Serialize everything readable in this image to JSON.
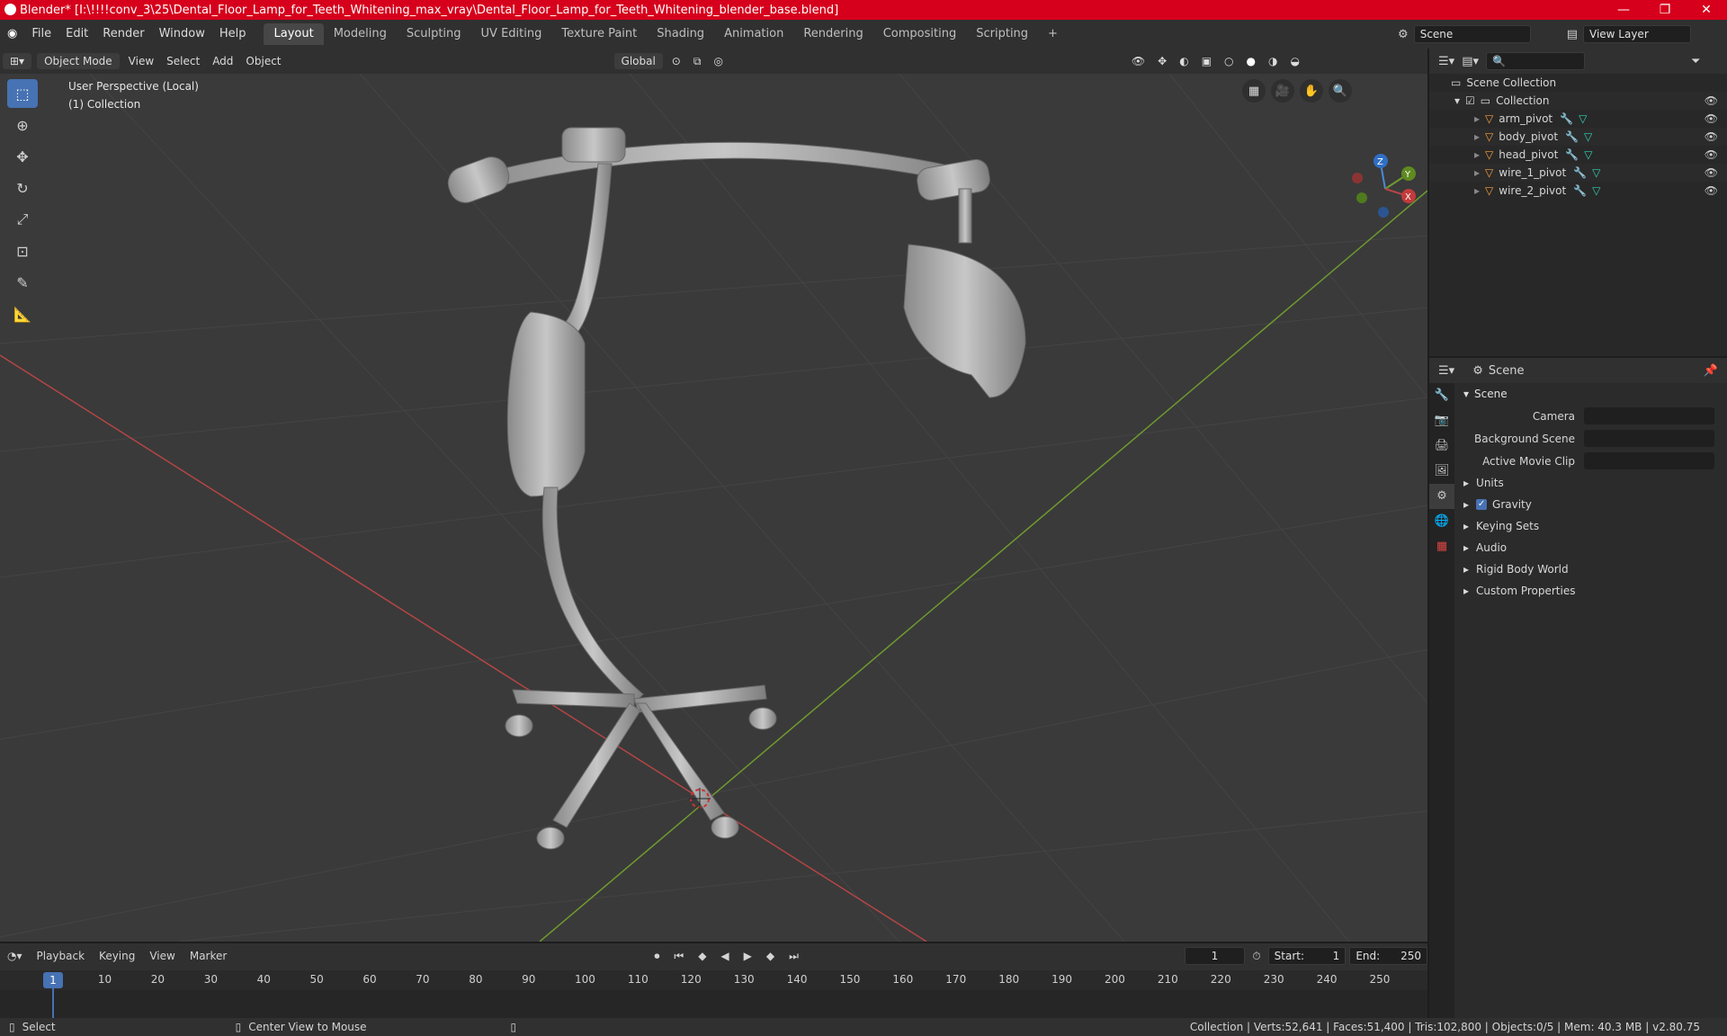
{
  "titlebar": {
    "title": "Blender* [I:\\!!!!conv_3\\25\\Dental_Floor_Lamp_for_Teeth_Whitening_max_vray\\Dental_Floor_Lamp_for_Teeth_Whitening_blender_base.blend]",
    "min": "—",
    "max": "❐",
    "close": "✕"
  },
  "menu": {
    "items": [
      "File",
      "Edit",
      "Render",
      "Window",
      "Help"
    ]
  },
  "workspaces": [
    "Layout",
    "Modeling",
    "Sculpting",
    "UV Editing",
    "Texture Paint",
    "Shading",
    "Animation",
    "Rendering",
    "Compositing",
    "Scripting"
  ],
  "workspace_add": "+",
  "scene": {
    "scene_name": "Scene",
    "view_layer": "View Layer"
  },
  "viewport_header": {
    "mode": "Object Mode",
    "view": "View",
    "select": "Select",
    "add": "Add",
    "object": "Object",
    "orientation": "Global"
  },
  "viewport": {
    "perspective": "User Perspective (Local)",
    "collection": "(1) Collection"
  },
  "axes": {
    "z": "Z",
    "y": "Y",
    "x": "X"
  },
  "outliner": {
    "scene_collection": "Scene Collection",
    "collection": "Collection",
    "objects": [
      "arm_pivot",
      "body_pivot",
      "head_pivot",
      "wire_1_pivot",
      "wire_2_pivot"
    ]
  },
  "properties": {
    "header": "Scene",
    "panel": "Scene",
    "camera_label": "Camera",
    "bg_scene_label": "Background Scene",
    "movie_clip_label": "Active Movie Clip",
    "subpanels": [
      "Units",
      "Gravity",
      "Keying Sets",
      "Audio",
      "Rigid Body World",
      "Custom Properties"
    ],
    "gravity_checked": true
  },
  "timeline": {
    "playback": "Playback",
    "keying": "Keying",
    "view": "View",
    "marker": "Marker",
    "current_frame": "1",
    "start_label": "Start:",
    "start": "1",
    "end_label": "End:",
    "end": "250",
    "ticks": [
      "10",
      "20",
      "30",
      "40",
      "50",
      "60",
      "70",
      "80",
      "90",
      "100",
      "110",
      "120",
      "130",
      "140",
      "150",
      "160",
      "170",
      "180",
      "190",
      "200",
      "210",
      "220",
      "230",
      "240",
      "250"
    ],
    "current": "1"
  },
  "status": {
    "select": "Select",
    "center": "Center View to Mouse",
    "stats": "Collection | Verts:52,641 | Faces:51,400 | Tris:102,800 | Objects:0/5 | Mem: 40.3 MB | v2.80.75"
  },
  "colors": {
    "accent": "#4772b3",
    "titlebar": "#d6001c",
    "x_axis": "#b54545",
    "y_axis": "#6f9a2f"
  }
}
